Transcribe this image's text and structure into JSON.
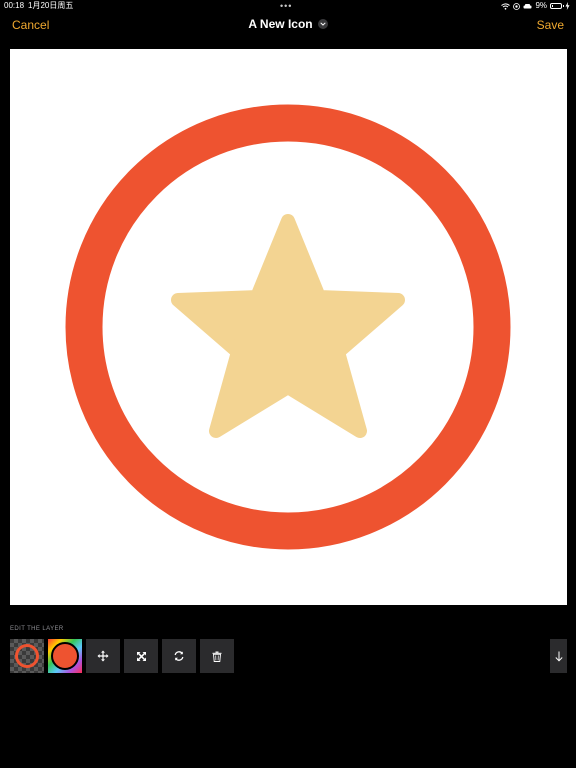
{
  "status_bar": {
    "time": "00:18",
    "date": "1月20日周五",
    "dots": "•••",
    "battery": "9%",
    "battery_level": 0.09
  },
  "nav": {
    "cancel_label": "Cancel",
    "title": "A New Icon",
    "save_label": "Save"
  },
  "canvas": {
    "background": "#ffffff",
    "ring_color": "#ee5330",
    "star_color": "#f3d492"
  },
  "edit_panel": {
    "label": "EDIT THE LAYER",
    "tools": [
      "layer-thumbnail",
      "color-swatch",
      "move-icon",
      "resize-icon",
      "rotate-icon",
      "trash-icon"
    ]
  },
  "colors": {
    "accent": "#f0a92f",
    "background": "#000000",
    "tool_bg": "#2b2b2d"
  }
}
